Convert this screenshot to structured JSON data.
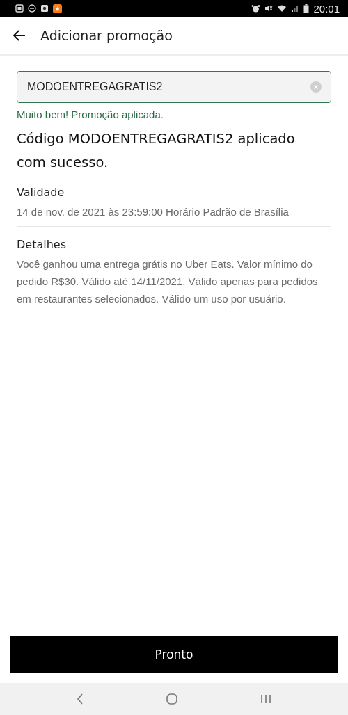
{
  "status_bar": {
    "time": "20:01"
  },
  "header": {
    "title": "Adicionar promoção"
  },
  "promo_field": {
    "value": "MODOENTREGAGRATIS2"
  },
  "success_message": "Muito bem! Promoção aplicada.",
  "headline": "Código MODOENTREGAGRATIS2 aplicado com sucesso.",
  "sections": [
    {
      "title": "Validade",
      "text": "14 de nov. de 2021 às 23:59:00 Horário Padrão de Brasília"
    },
    {
      "title": "Detalhes",
      "text": "Você ganhou uma entrega grátis no Uber Eats. Valor mínimo do pedido R$30. Válido até 14/11/2021. Válido apenas para pedidos em restaurantes selecionados. Válido um uso por usuário."
    }
  ],
  "done_button": "Pronto"
}
